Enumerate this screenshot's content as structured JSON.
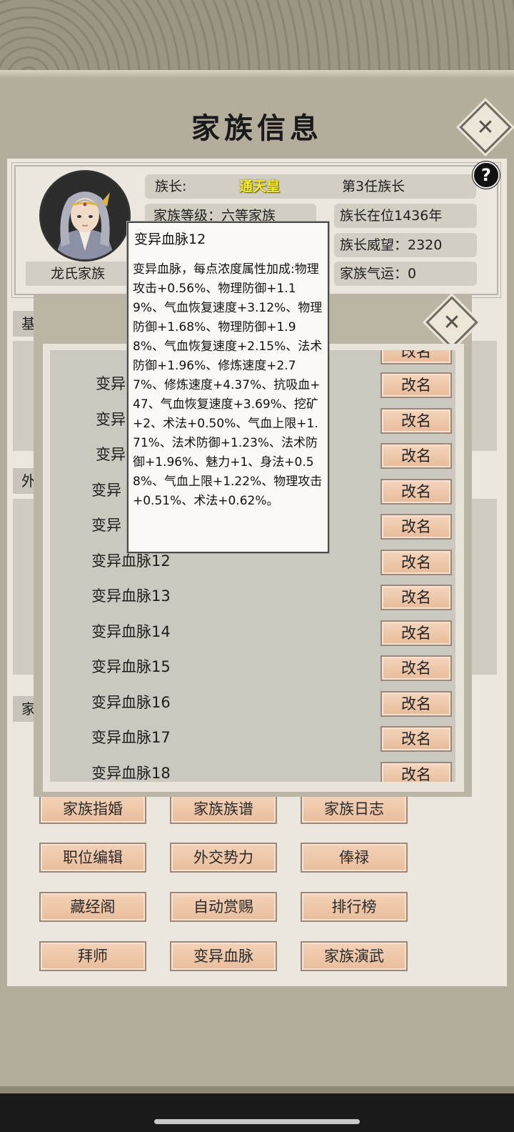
{
  "title": "家族信息",
  "info": {
    "family_name": "龙氏家族",
    "patriarch_label": "族长:",
    "patriarch_name": "通天皇",
    "patriarch_order": "第3任族长",
    "level": "家族等级：六等家族",
    "tenure": "族长在位1436年",
    "prestige": "族长威望：2320",
    "fortune": "家族气运：0"
  },
  "sections": [
    "基",
    "外",
    "家"
  ],
  "actions": [
    "家族指婚",
    "家族族谱",
    "家族日志",
    "职位编辑",
    "外交势力",
    "俸禄",
    "藏经阁",
    "自动赏赐",
    "排行榜",
    "拜师",
    "变异血脉",
    "家族演武"
  ],
  "modal": {
    "rename_label": "改名",
    "items": [
      {
        "name": "变异"
      },
      {
        "name": "变异"
      },
      {
        "name": "变异"
      },
      {
        "name": "变异"
      },
      {
        "name": "变异"
      },
      {
        "name": "变异血脉12"
      },
      {
        "name": "变异血脉13"
      },
      {
        "name": "变异血脉14"
      },
      {
        "name": "变异血脉15"
      },
      {
        "name": "变异血脉16"
      },
      {
        "name": "变异血脉17"
      },
      {
        "name": "变异血脉18"
      }
    ]
  },
  "tooltip": {
    "title": "变异血脉12",
    "body": "变异血脉，每点浓度属性加成:物理攻击+0.56%、物理防御+1.19%、气血恢复速度+3.12%、物理防御+1.68%、物理防御+1.98%、气血恢复速度+2.15%、法术防御+1.96%、修炼速度+2.77%、修炼速度+4.37%、抗吸血+47、气血恢复速度+3.69%、挖矿+2、术法+0.50%、气血上限+1.71%、法术防御+1.23%、法术防御+1.96%、魅力+1、身法+0.58%、气血上限+1.22%、物理攻击+0.51%、术法+0.62%。"
  }
}
